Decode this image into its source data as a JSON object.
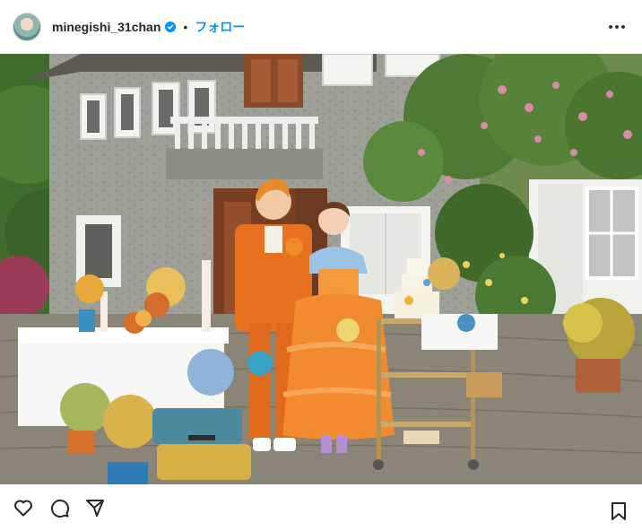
{
  "post": {
    "username": "minegishi_31chan",
    "separator": "•",
    "follow_label": "フォロー",
    "verified_icon": "verified-badge-icon",
    "more_icon": "more-options-icon"
  },
  "photo": {
    "alt": "Wedding couple in orange outfits in front of an ivy-covered stone house"
  },
  "actions": {
    "like_icon": "heart-icon",
    "comment_icon": "comment-icon",
    "share_icon": "share-icon",
    "save_icon": "bookmark-icon"
  },
  "colors": {
    "accent": "#0095f6",
    "text": "#262626"
  }
}
